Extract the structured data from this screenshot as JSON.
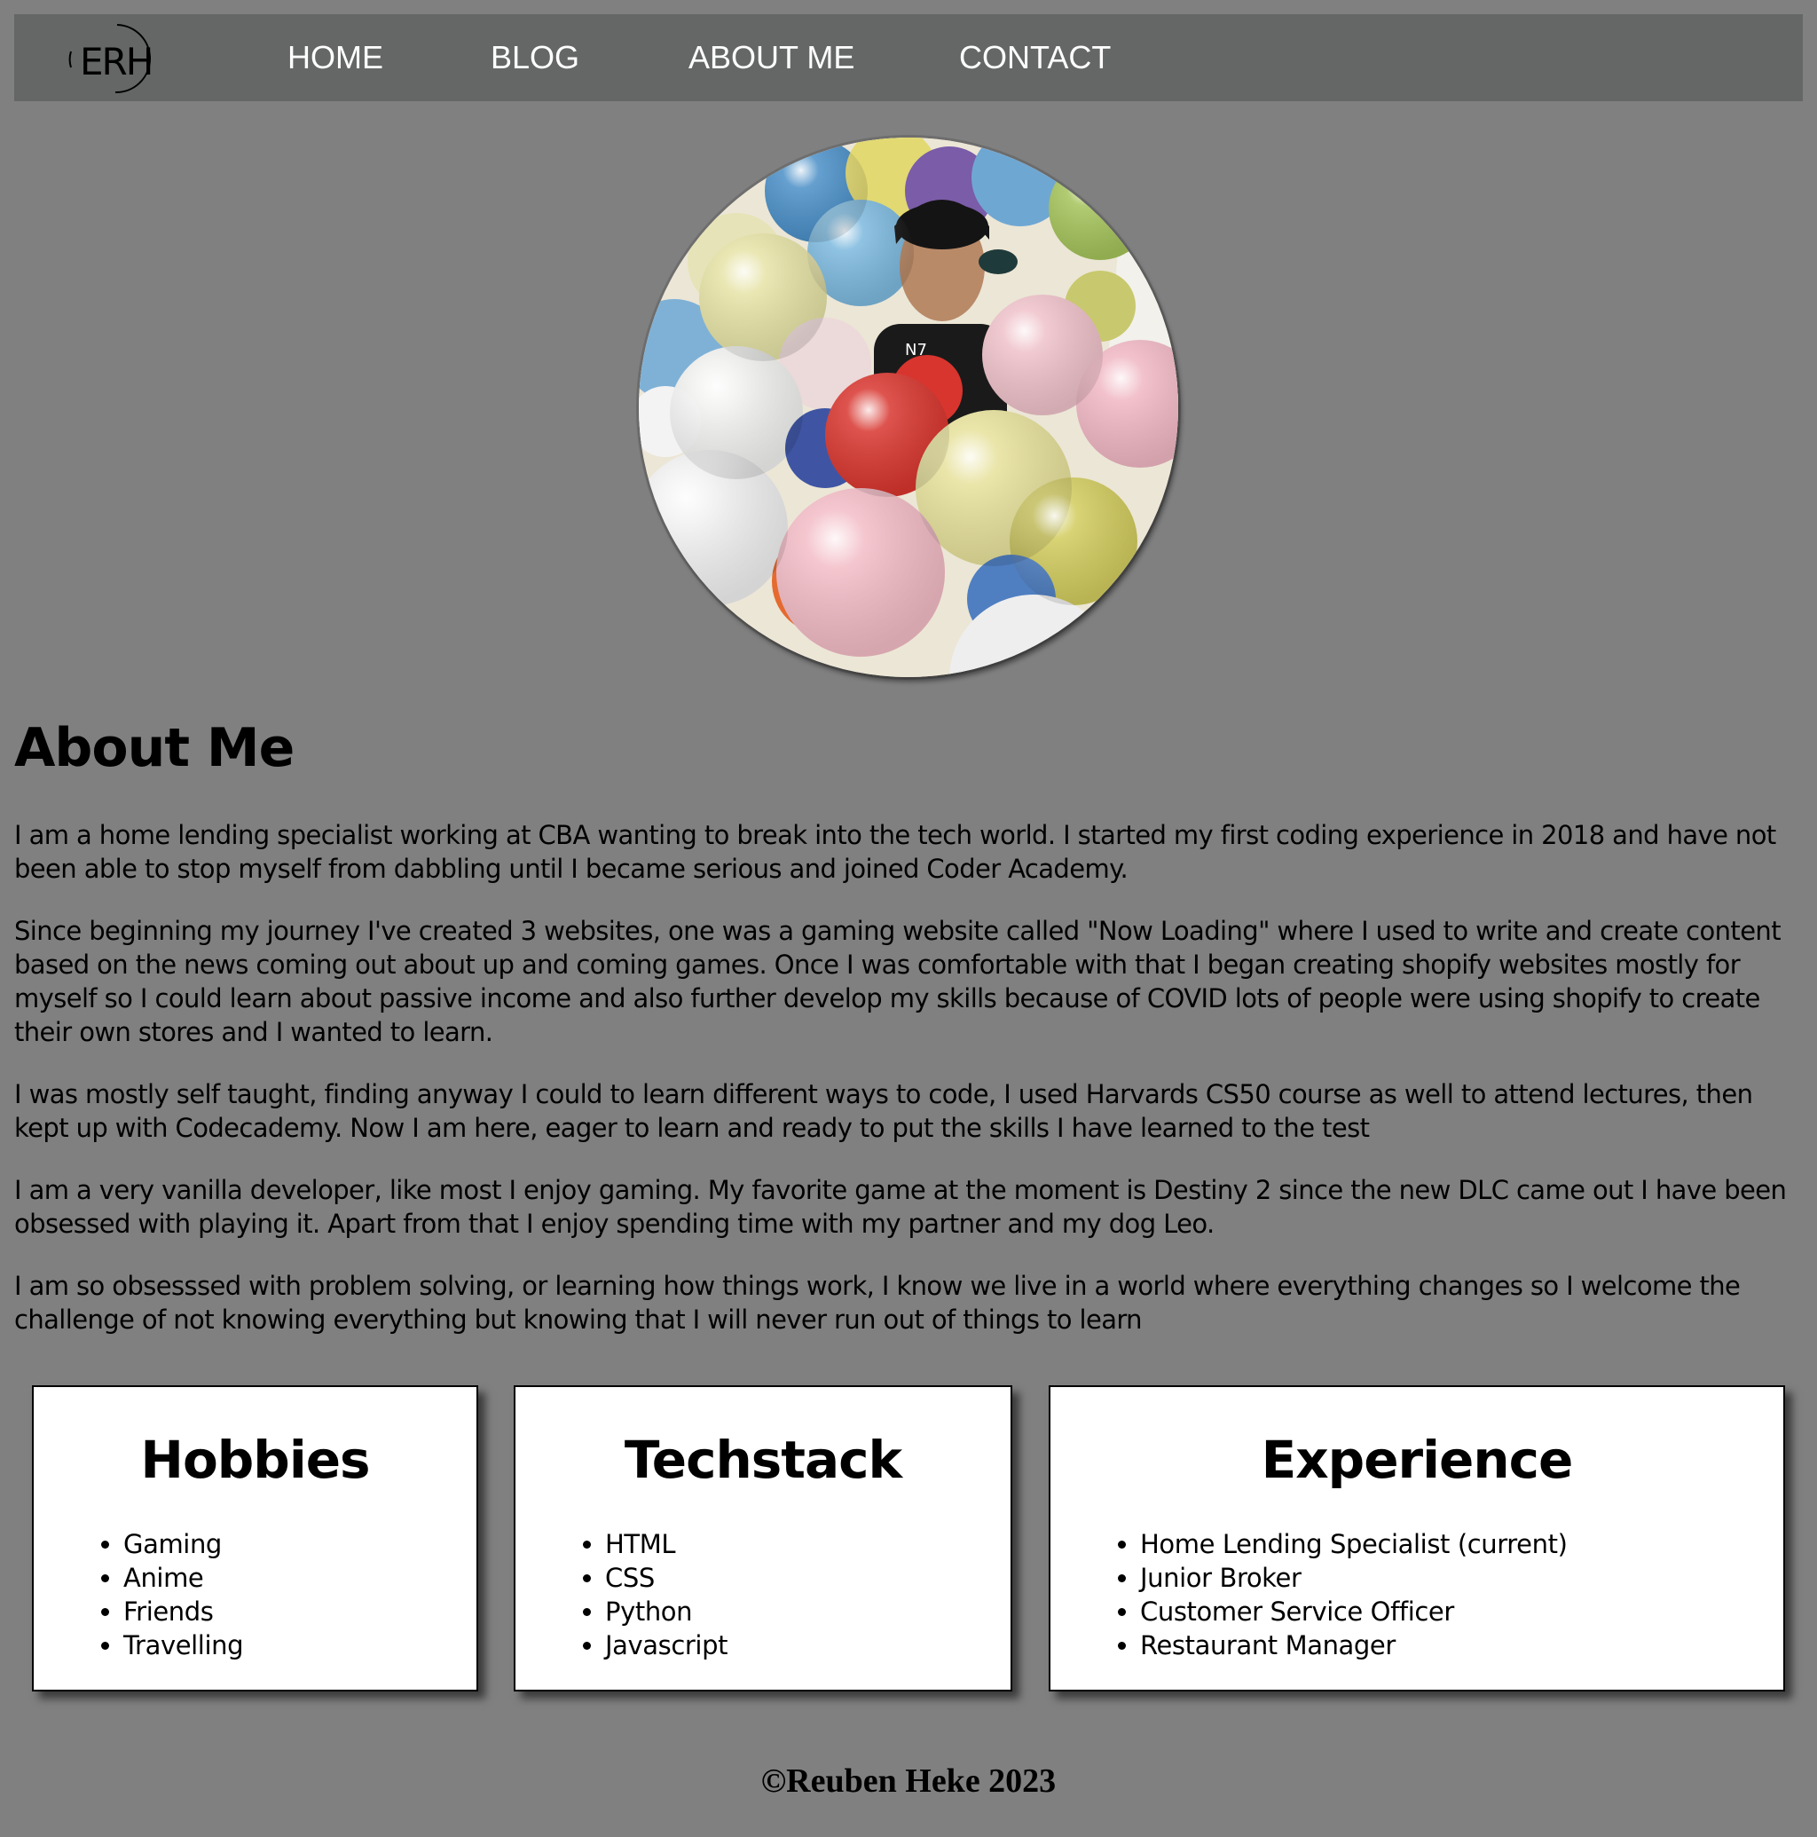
{
  "nav": {
    "logo_text": "ERH",
    "links": [
      {
        "label": "HOME"
      },
      {
        "label": "BLOG"
      },
      {
        "label": "ABOUT ME"
      },
      {
        "label": "CONTACT"
      }
    ]
  },
  "about": {
    "title": "About Me",
    "paragraphs": [
      "I am a home lending specialist working at CBA wanting to break into the tech world. I started my first coding experience in 2018 and have not been able to stop myself from dabbling until I became serious and joined Coder Academy.",
      "Since beginning my journey I've created 3 websites, one was a gaming website called \"Now Loading\" where I used to write and create content based on the news coming out about up and coming games. Once I was comfortable with that I began creating shopify websites mostly for myself so I could learn about passive income and also further develop my skills because of COVID lots of people were using shopify to create their own stores and I wanted to learn.",
      "I was mostly self taught, finding anyway I could to learn different ways to code, I used Harvards CS50 course as well to attend lectures, then kept up with Codecademy. Now I am here, eager to learn and ready to put the skills I have learned to the test",
      "I am a very vanilla developer, like most I enjoy gaming. My favorite game at the moment is Destiny 2 since the new DLC came out I have been obsessed with playing it. Apart from that I enjoy spending time with my partner and my dog Leo.",
      "I am so obsesssed with problem solving, or learning how things work, I know we live in a world where everything changes so I welcome the challenge of not knowing everything but knowing that I will never run out of things to learn"
    ]
  },
  "cards": {
    "hobbies": {
      "title": "Hobbies",
      "items": [
        "Gaming",
        "Anime",
        "Friends",
        "Travelling"
      ]
    },
    "techstack": {
      "title": "Techstack",
      "items": [
        "HTML",
        "CSS",
        "Python",
        "Javascript"
      ]
    },
    "experience": {
      "title": "Experience",
      "items": [
        "Home Lending Specialist (current)",
        "Junior Broker",
        "Customer Service Officer",
        "Restaurant Manager"
      ]
    }
  },
  "footer": {
    "text": "©Reuben Heke 2023"
  },
  "colors": {
    "page_background": "#808080",
    "navbar_background": "#646766",
    "nav_text": "#ffffff",
    "card_background": "#ffffff"
  },
  "icons": {
    "logo": "erh-circle-logo",
    "photo": "profile-photo-balloons"
  }
}
